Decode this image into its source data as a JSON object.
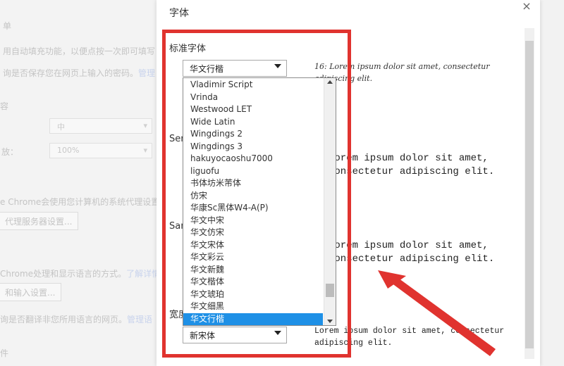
{
  "background": {
    "frag1": "单",
    "frag2": "用自动填充功能，以便点按一次即可填写",
    "frag3": "询是否保存您在网页上输入的密码。",
    "frag3_link": "管理",
    "frag4": "容",
    "frag5_label": "放：",
    "select1": "中",
    "select2": "100%",
    "frag6": "e Chrome会使用您计算机的系统代理设置",
    "btn1": "代理服务器设置...",
    "frag7": "Chrome处理和显示语言的方式。",
    "frag7_link": "了解详情",
    "btn2": "和输入设置...",
    "frag8": "询是否翻译非您所用语言的网页。",
    "frag8_link": "管理语",
    "frag9": "件"
  },
  "dialog": {
    "title": "字体",
    "close": "×",
    "standard_label": "标准字体",
    "standard_selected": "华文行楷",
    "serif_label": "Ser",
    "sans_label": "San",
    "fixed_label": "宽度",
    "fixed_selected": "新宋体",
    "preview_standard": "16: Lorem ipsum dolor sit amet, consectetur adipiscing elit.",
    "preview_serif": "Lorem ipsum dolor sit amet, consectetur adipiscing elit.",
    "preview_sans": "Lorem ipsum dolor sit amet, consectetur adipiscing elit.",
    "preview_fixed": "Lorem ipsum dolor sit amet, consectetur adipiscing elit."
  },
  "dropdown_items": [
    "Vladimir Script",
    "Vrinda",
    "Westwood LET",
    "Wide Latin",
    "Wingdings 2",
    "Wingdings 3",
    "hakuyocaoshu7000",
    "liguofu",
    "书体坊米芾体",
    "仿宋",
    "华康Sc黑体W4-A(P)",
    "华文中宋",
    "华文仿宋",
    "华文宋体",
    "华文彩云",
    "华文新魏",
    "华文楷体",
    "华文琥珀",
    "华文细黑",
    "华文行楷"
  ],
  "selected_index": 19,
  "colors": {
    "highlight": "#1e90e6",
    "annotation": "#e0332f"
  }
}
